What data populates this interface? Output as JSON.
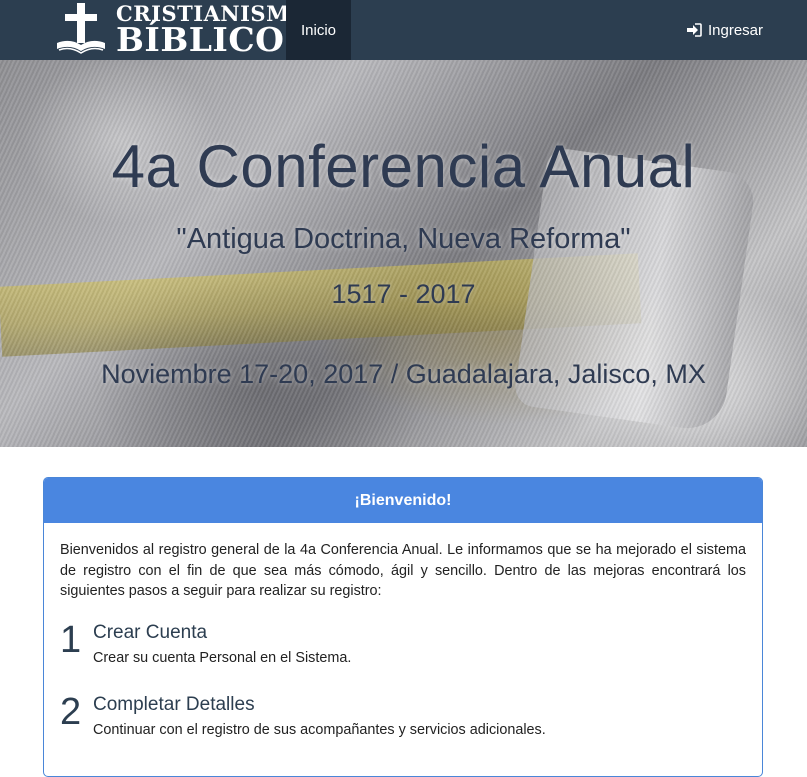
{
  "navbar": {
    "brand_line1": "CRISTIANISMO",
    "brand_line2": "BÍBLICO",
    "home_label": "Inicio",
    "login_label": "Ingresar",
    "bg_color": "#2c3e50",
    "login_icon": "sign-in-icon"
  },
  "hero": {
    "title": "4a Conferencia Anual",
    "subtitle": "\"Antigua Doctrina, Nueva Reforma\"",
    "years": "1517 - 2017",
    "date_location": "Noviembre 17-20, 2017 / Guadalajara, Jalisco, MX"
  },
  "welcome": {
    "header": "¡Bienvenido!",
    "header_color": "#4a86e0",
    "intro": "Bienvenidos al registro general de la 4a Conferencia Anual. Le informamos que se ha mejorado el sistema de registro con el fin de que sea más cómodo, ágil y sencillo. Dentro de las mejoras encontrará los siguientes pasos a seguir para realizar su registro:",
    "steps": [
      {
        "number": "1",
        "title": "Crear Cuenta",
        "description": "Crear su cuenta Personal en el Sistema."
      },
      {
        "number": "2",
        "title": "Completar Detalles",
        "description": "Continuar con el registro de sus acompañantes y servicios adicionales."
      }
    ]
  }
}
